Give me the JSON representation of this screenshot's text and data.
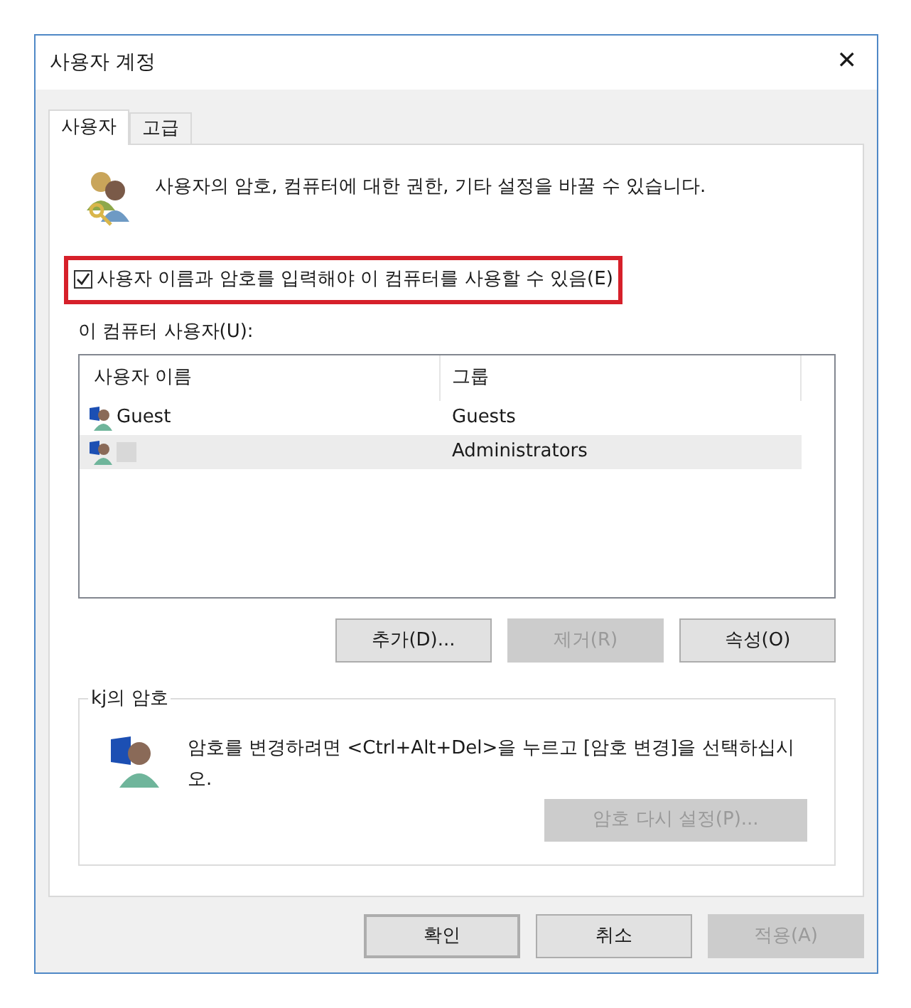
{
  "window": {
    "title": "사용자 계정",
    "close": "✕"
  },
  "tabs": [
    {
      "label": "사용자",
      "selected": true
    },
    {
      "label": "고급",
      "selected": false
    }
  ],
  "description": "사용자의 암호, 컴퓨터에 대한 권한, 기타 설정을 바꿀 수 있습니다.",
  "require_login": {
    "label": "사용자 이름과 암호를 입력해야 이 컴퓨터를 사용할 수 있음(E)",
    "checked": true,
    "highlighted": true
  },
  "users_label": "이 컴퓨터 사용자(U):",
  "table": {
    "columns": [
      "사용자 이름",
      "그룹"
    ],
    "rows": [
      {
        "name": "Guest",
        "group": "Guests",
        "selected": false,
        "redacted": false
      },
      {
        "name": "",
        "group": "Administrators",
        "selected": true,
        "redacted": true
      }
    ]
  },
  "list_buttons": [
    {
      "label": "추가(D)...",
      "disabled": false
    },
    {
      "label": "제거(R)",
      "disabled": true
    },
    {
      "label": "속성(O)",
      "disabled": false
    }
  ],
  "password_group": {
    "title": "kj의 암호",
    "text": "암호를 변경하려면 <Ctrl+Alt+Del>을 누르고 [암호 변경]을 선택하십시오.",
    "button": {
      "label": "암호 다시 설정(P)...",
      "disabled": true
    }
  },
  "dialog_buttons": [
    {
      "label": "확인",
      "disabled": false,
      "default": true
    },
    {
      "label": "취소",
      "disabled": false,
      "default": false
    },
    {
      "label": "적용(A)",
      "disabled": true,
      "default": false
    }
  ]
}
